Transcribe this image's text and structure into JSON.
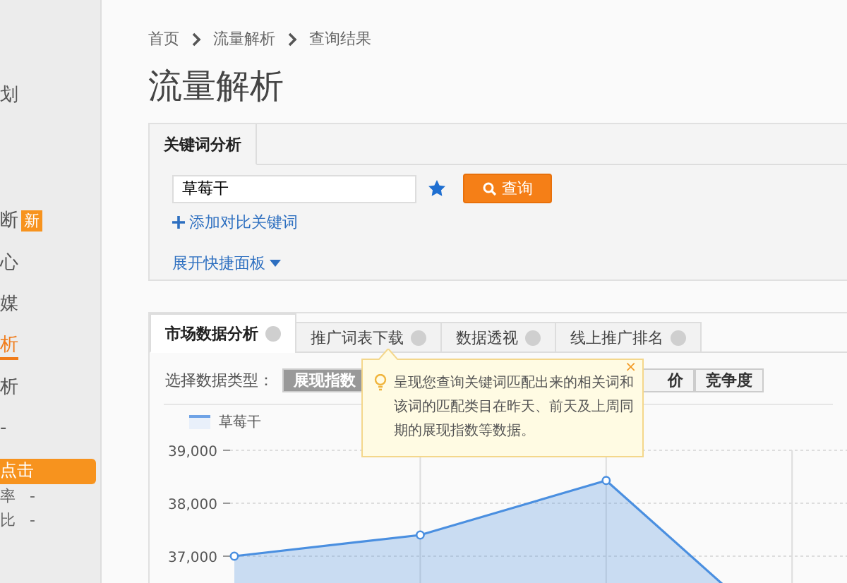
{
  "sidebar": {
    "items": [
      {
        "label": "划",
        "selected": false
      },
      {
        "label": "断",
        "selected": false,
        "badge": "新"
      },
      {
        "label": "心",
        "selected": false
      },
      {
        "label": "媒",
        "selected": false
      },
      {
        "label": "析",
        "selected": true
      },
      {
        "label": "析",
        "selected": false
      },
      {
        "label": "-",
        "selected": false
      }
    ],
    "highlight": "点击",
    "metrics": [
      {
        "label": "率",
        "value": "-"
      },
      {
        "label": "比",
        "value": "-"
      }
    ]
  },
  "breadcrumb": [
    "首页",
    "流量解析",
    "查询结果"
  ],
  "title": "流量解析",
  "keyword_panel": {
    "tabs": [
      {
        "label": "关键词分析",
        "selected": true
      }
    ],
    "keyword": "草莓干",
    "query_button": "查询",
    "add_compare": "添加对比关键词",
    "expand": "展开快捷面板"
  },
  "analysis": {
    "tabs": [
      {
        "label": "市场数据分析",
        "selected": true
      },
      {
        "label": "推广词表下载",
        "selected": false
      },
      {
        "label": "数据透视",
        "selected": false
      },
      {
        "label": "线上推广排名",
        "selected": false
      }
    ],
    "data_type_label": "选择数据类型：",
    "data_types": [
      {
        "label": "展现指数",
        "selected": true
      },
      {
        "label": "价",
        "selected": false
      },
      {
        "label": "竞争度",
        "selected": false
      }
    ],
    "tooltip_close": "×",
    "tooltip": "呈现您查询关键词匹配出来的相关词和该词的匹配类目在昨天、前天及上周同期的展现指数等数据。",
    "chart_data": {
      "type": "area",
      "series": [
        {
          "name": "草莓干",
          "color": "#4a8fe0",
          "values": [
            37000,
            37400,
            38430,
            35300
          ]
        }
      ],
      "ylim": [
        35000,
        39000
      ],
      "grid": true,
      "yticks": [
        {
          "value": 37000,
          "label": "37,000"
        },
        {
          "value": 38000,
          "label": "38,000"
        },
        {
          "value": 39000,
          "label": "39,000"
        }
      ]
    }
  }
}
